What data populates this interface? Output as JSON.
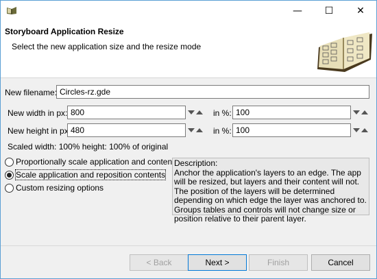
{
  "window": {
    "minimize_glyph": "—",
    "maximize_glyph": "☐",
    "close_glyph": "✕"
  },
  "header": {
    "title": "Storyboard Application Resize",
    "subtitle": "Select the new application size and the resize mode"
  },
  "form": {
    "filename_label": "New filename:",
    "filename_value": "Circles-rz.gde",
    "width_label": "New width in px:",
    "width_value": "800",
    "width_pct_label": "in %:",
    "width_pct_value": "100",
    "height_label": "New height in px:",
    "height_value": "480",
    "height_pct_label": "in %:",
    "height_pct_value": "100",
    "scaled_text": "Scaled width: 100%  height: 100% of original"
  },
  "modes": [
    {
      "label": "Proportionally scale application and contents",
      "selected": false
    },
    {
      "label": "Scale application and reposition contents",
      "selected": true
    },
    {
      "label": "Custom resizing options",
      "selected": false
    }
  ],
  "description": {
    "heading": "Description:",
    "body": "Anchor the application's layers to an edge.  The app will be resized, but layers and their content will not.  The position of the layers will be determined depending on which edge the layer was anchored to.  Groups tables and controls will not change size or position relative to their parent layer."
  },
  "buttons": {
    "back": "< Back",
    "next": "Next >",
    "finish": "Finish",
    "cancel": "Cancel"
  },
  "colors": {
    "window_border": "#5a9fd4",
    "dialog_bg": "#f0f0f0",
    "default_button_border": "#0078d7"
  }
}
